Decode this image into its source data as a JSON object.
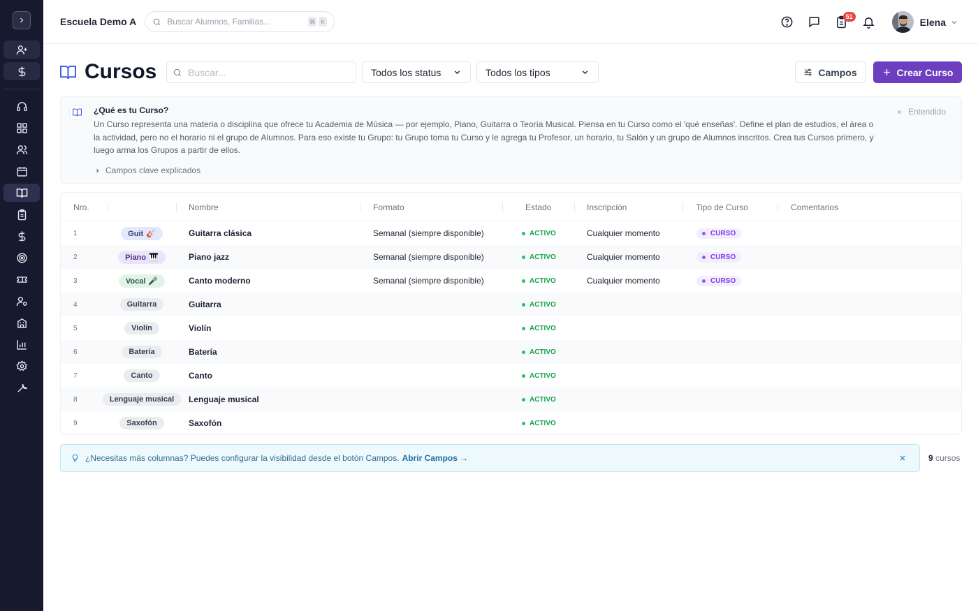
{
  "topbar": {
    "school": "Escuela Demo A",
    "search_placeholder": "Buscar Alumnos, Familias...",
    "kbd_1": "⌘",
    "kbd_2": "K",
    "notif_count": "51",
    "user_name": "Elena"
  },
  "page": {
    "title": "Cursos",
    "search_placeholder": "Buscar...",
    "status_filter": "Todos los status",
    "type_filter": "Todos los tipos",
    "campos_label": "Campos",
    "crear_label": "Crear Curso"
  },
  "info": {
    "title": "¿Qué es tu Curso?",
    "body": "Un Curso representa una materia o disciplina que ofrece tu Academia de Música — por ejemplo, Piano, Guitarra o Teoría Musical. Piensa en tu Curso como el 'qué enseñas'. Define el plan de estudios, el área o la actividad, pero no el horario ni el grupo de Alumnos. Para eso existe tu Grupo: tu Grupo toma tu Curso y le agrega tu Profesor, un horario, tu Salón y un grupo de Alumnos inscritos. Crea tus Cursos primero, y luego arma los Grupos a partir de ellos.",
    "toggle": "Campos clave explicados",
    "dismiss": "Entendido"
  },
  "table": {
    "headers": {
      "num": "Nro.",
      "nombre": "Nombre",
      "formato": "Formato",
      "estado": "Estado",
      "inscripcion": "Inscripción",
      "tipo": "Tipo de Curso",
      "comentarios": "Comentarios"
    },
    "rows": [
      {
        "num": "1",
        "chip": "Guit",
        "emoji": "🎸",
        "nombre": "Guitarra clásica",
        "formato": "Semanal (siempre disponible)",
        "estado": "ACTIVO",
        "inscripcion": "Cualquier momento",
        "tipo": "CURSO"
      },
      {
        "num": "2",
        "chip": "Piano",
        "emoji": "🎹",
        "nombre": "Piano jazz",
        "formato": "Semanal (siempre disponible)",
        "estado": "ACTIVO",
        "inscripcion": "Cualquier momento",
        "tipo": "CURSO"
      },
      {
        "num": "3",
        "chip": "Vocal",
        "emoji": "🎤",
        "nombre": "Canto moderno",
        "formato": "Semanal (siempre disponible)",
        "estado": "ACTIVO",
        "inscripcion": "Cualquier momento",
        "tipo": "CURSO"
      },
      {
        "num": "4",
        "chip": "Guitarra",
        "emoji": "",
        "nombre": "Guitarra",
        "formato": "",
        "estado": "ACTIVO",
        "inscripcion": "",
        "tipo": ""
      },
      {
        "num": "5",
        "chip": "Violín",
        "emoji": "",
        "nombre": "Violín",
        "formato": "",
        "estado": "ACTIVO",
        "inscripcion": "",
        "tipo": ""
      },
      {
        "num": "6",
        "chip": "Batería",
        "emoji": "",
        "nombre": "Batería",
        "formato": "",
        "estado": "ACTIVO",
        "inscripcion": "",
        "tipo": ""
      },
      {
        "num": "7",
        "chip": "Canto",
        "emoji": "",
        "nombre": "Canto",
        "formato": "",
        "estado": "ACTIVO",
        "inscripcion": "",
        "tipo": ""
      },
      {
        "num": "8",
        "chip": "Lenguaje musical",
        "emoji": "",
        "nombre": "Lenguaje musical",
        "formato": "",
        "estado": "ACTIVO",
        "inscripcion": "",
        "tipo": ""
      },
      {
        "num": "9",
        "chip": "Saxofón",
        "emoji": "",
        "nombre": "Saxofón",
        "formato": "",
        "estado": "ACTIVO",
        "inscripcion": "",
        "tipo": ""
      }
    ]
  },
  "tip": {
    "text": "¿Necesitas más columnas? Puedes configurar la visibilidad desde el botón Campos.",
    "link": "Abrir Campos →"
  },
  "footer": {
    "count": "9",
    "count_label": "cursos"
  },
  "colors": {
    "sidebar_bg": "#171a2e",
    "accent": "#6d3fc0",
    "status_green": "#16a34a",
    "tipo_purple": "#7c3aed",
    "tip_bg": "#eef9fe"
  }
}
